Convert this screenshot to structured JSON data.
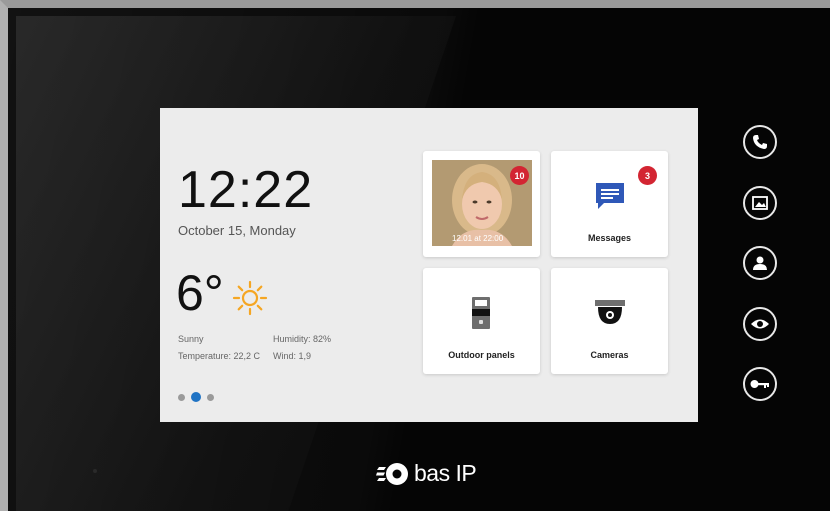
{
  "clock": {
    "time": "12:22",
    "date": "October 15, Monday"
  },
  "weather": {
    "temperature": "6°",
    "condition": "Sunny",
    "humidity": "Humidity: 82%",
    "temperature_detail": "Temperature: 22,2 C",
    "wind": "Wind: 1,9",
    "icon": "sun-icon",
    "icon_color": "#f5a623"
  },
  "pager": {
    "pages": 3,
    "active_index": 1,
    "active_color": "#1f73c4"
  },
  "tiles": {
    "visitor_photo": {
      "timestamp": "12.01 at 22:00",
      "badge": "10"
    },
    "messages": {
      "label": "Messages",
      "badge": "3",
      "icon": "message-icon",
      "icon_color": "#2f58b8"
    },
    "outdoor_panels": {
      "label": "Outdoor panels",
      "icon": "intercom-panel-icon"
    },
    "cameras": {
      "label": "Cameras",
      "icon": "dome-camera-icon"
    }
  },
  "badge_color": "#d32532",
  "side_buttons": [
    "phone-icon",
    "gallery-icon",
    "contact-icon",
    "eye-icon",
    "key-icon"
  ],
  "brand": {
    "name": "bas IP"
  }
}
